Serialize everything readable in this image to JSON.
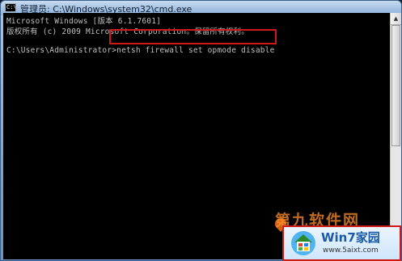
{
  "window": {
    "title": "管理员: C:\\Windows\\system32\\cmd.exe",
    "icon_text": "C:\\"
  },
  "console": {
    "lines": [
      "Microsoft Windows [版本 6.1.7601]",
      "版权所有 (c) 2009 Microsoft Corporation。保留所有权利。",
      "",
      "C:\\Users\\Administrator>netsh firewall set opmode disable"
    ],
    "highlighted_command": "netsh firewall set opmode disable",
    "highlight_color": "#d01818",
    "text_color": "#c0c0c0",
    "background": "#000000"
  },
  "watermark": {
    "brand": "第九软件网",
    "badge_title": "Win7家园",
    "badge_url": "www.5aixt.com"
  }
}
